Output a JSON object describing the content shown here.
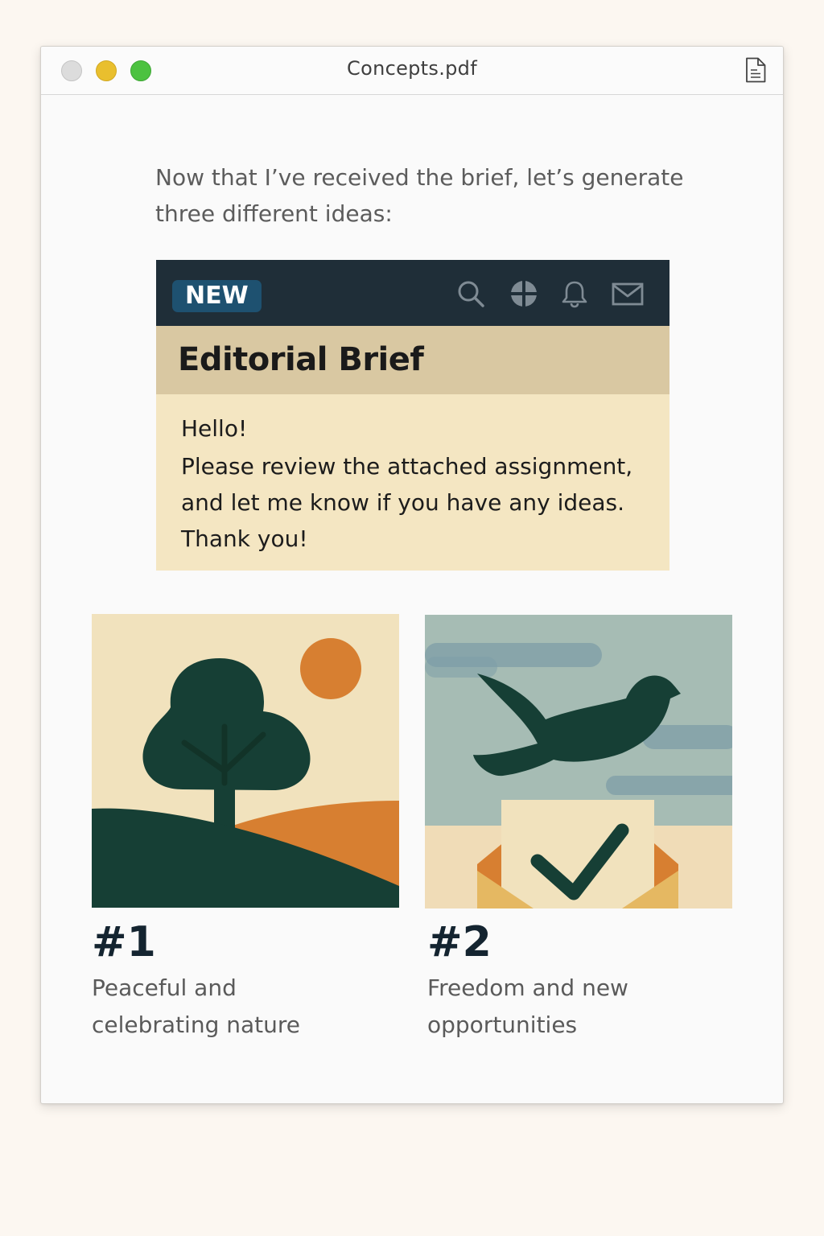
{
  "window": {
    "title": "Concepts.pdf",
    "icons": [
      "close-icon",
      "minimize-icon",
      "zoom-icon",
      "document-icon"
    ]
  },
  "intro": {
    "line1": "Now that I’ve received the brief, let’s generate",
    "line2": "three different ideas:"
  },
  "brief_card": {
    "badge": "NEW",
    "toolbar_icons": [
      "search-icon",
      "grid-icon",
      "bell-icon",
      "mail-icon"
    ],
    "title": "Editorial Brief",
    "lines": [
      "Hello!",
      "Please review the attached assignment,",
      "and let me know if you have any ideas.",
      "Thank you!"
    ]
  },
  "concepts": [
    {
      "number": "#1",
      "caption_line1": "Peaceful and",
      "caption_line2": "celebrating nature",
      "illustration": "tree-hill-sun-illustration"
    },
    {
      "number": "#2",
      "caption_line1": "Freedom and new",
      "caption_line2": "opportunities",
      "illustration": "bird-envelope-check-illustration"
    }
  ],
  "colors": {
    "page_bg": "#fcf7f1",
    "dark_green": "#163f35",
    "orange": "#d77f31",
    "cream": "#f1e2bd",
    "navy": "#1f2e38",
    "badge_blue": "#1e5170",
    "tan": "#d9c8a2"
  }
}
